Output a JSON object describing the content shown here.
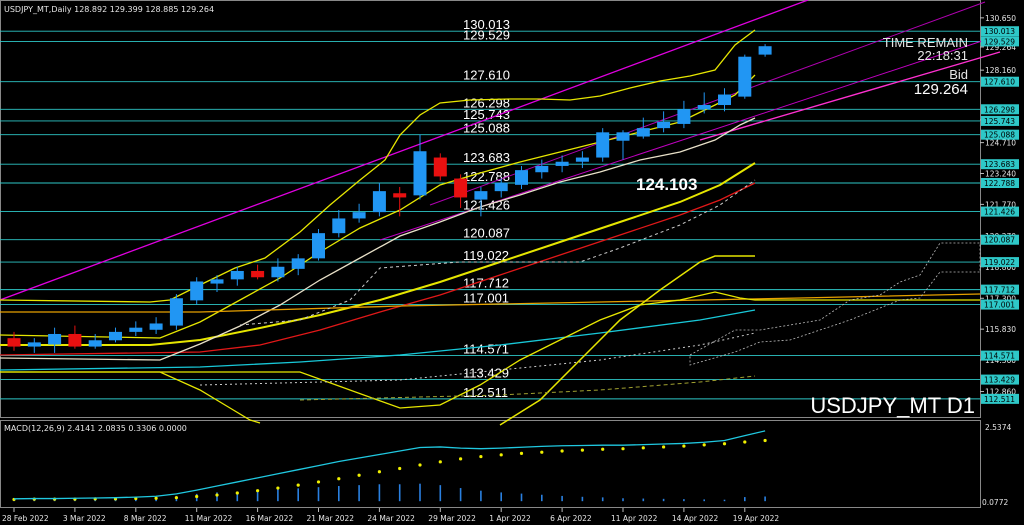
{
  "header": {
    "symbol_info": "USDJPY_MT,Daily  128.892 129.399 128.885 129.264"
  },
  "overlay": {
    "symbol_big": "USDJPY_MT D1",
    "time_remain_label": "TIME REMAIN",
    "time_remain_value": "22:18:31",
    "bid_label": "Bid",
    "bid_value": "129.264",
    "callout": "124.103"
  },
  "chart_data": {
    "type": "candlestick",
    "price_axis": {
      "range": [
        111.6,
        131.5
      ],
      "ticks": [
        "130.650",
        "129.264",
        "128.160",
        "125.790",
        "124.710",
        "123.240",
        "121.770",
        "120.270",
        "118.800",
        "117.300",
        "115.830",
        "114.360",
        "112.860"
      ],
      "tagged": [
        "130.013",
        "129.529",
        "127.610",
        "126.298",
        "125.743",
        "125.088",
        "123.683",
        "122.788",
        "121.426",
        "120.087",
        "119.022",
        "117.712",
        "117.001",
        "114.571",
        "113.429",
        "112.511"
      ]
    },
    "levels": [
      {
        "label": "130.013",
        "value": 130.013
      },
      {
        "label": "129.529",
        "value": 129.529
      },
      {
        "label": "127.610",
        "value": 127.61
      },
      {
        "label": "126.298",
        "value": 126.298
      },
      {
        "label": "125.743",
        "value": 125.743
      },
      {
        "label": "125.088",
        "value": 125.088
      },
      {
        "label": "123.683",
        "value": 123.683
      },
      {
        "label": "122.788",
        "value": 122.788
      },
      {
        "label": "121.426",
        "value": 121.426
      },
      {
        "label": "120.087",
        "value": 120.087
      },
      {
        "label": "119.022",
        "value": 119.022
      },
      {
        "label": "117.712",
        "value": 117.712
      },
      {
        "label": "117.001",
        "value": 117.001
      },
      {
        "label": "114.571",
        "value": 114.571
      },
      {
        "label": "113.429",
        "value": 113.429
      },
      {
        "label": "112.511",
        "value": 112.511
      }
    ],
    "x_labels": [
      {
        "label": "28 Feb 2022",
        "index": 0
      },
      {
        "label": "3 Mar 2022",
        "index": 3
      },
      {
        "label": "8 Mar 2022",
        "index": 6
      },
      {
        "label": "11 Mar 2022",
        "index": 9
      },
      {
        "label": "16 Mar 2022",
        "index": 12
      },
      {
        "label": "21 Mar 2022",
        "index": 15
      },
      {
        "label": "24 Mar 2022",
        "index": 18
      },
      {
        "label": "29 Mar 2022",
        "index": 21
      },
      {
        "label": "1 Apr 2022",
        "index": 24
      },
      {
        "label": "6 Apr 2022",
        "index": 27
      },
      {
        "label": "11 Apr 2022",
        "index": 30
      },
      {
        "label": "14 Apr 2022",
        "index": 33
      },
      {
        "label": "19 Apr 2022",
        "index": 36
      }
    ],
    "candles": [
      {
        "o": 115.4,
        "h": 115.7,
        "l": 114.8,
        "c": 115.0
      },
      {
        "o": 115.0,
        "h": 115.4,
        "l": 114.7,
        "c": 115.2
      },
      {
        "o": 115.1,
        "h": 115.9,
        "l": 114.7,
        "c": 115.6
      },
      {
        "o": 115.6,
        "h": 116.0,
        "l": 114.9,
        "c": 115.0
      },
      {
        "o": 115.0,
        "h": 115.6,
        "l": 114.9,
        "c": 115.3
      },
      {
        "o": 115.3,
        "h": 115.9,
        "l": 115.2,
        "c": 115.7
      },
      {
        "o": 115.7,
        "h": 116.2,
        "l": 115.5,
        "c": 115.9
      },
      {
        "o": 115.8,
        "h": 116.4,
        "l": 115.6,
        "c": 116.1
      },
      {
        "o": 116.0,
        "h": 117.5,
        "l": 115.8,
        "c": 117.3
      },
      {
        "o": 117.2,
        "h": 118.3,
        "l": 117.0,
        "c": 118.1
      },
      {
        "o": 118.0,
        "h": 118.4,
        "l": 117.6,
        "c": 118.2
      },
      {
        "o": 118.2,
        "h": 118.8,
        "l": 117.9,
        "c": 118.6
      },
      {
        "o": 118.6,
        "h": 118.9,
        "l": 118.2,
        "c": 118.3
      },
      {
        "o": 118.3,
        "h": 119.2,
        "l": 118.1,
        "c": 118.8
      },
      {
        "o": 118.7,
        "h": 119.4,
        "l": 118.4,
        "c": 119.2
      },
      {
        "o": 119.2,
        "h": 120.6,
        "l": 119.1,
        "c": 120.4
      },
      {
        "o": 120.4,
        "h": 121.5,
        "l": 120.2,
        "c": 121.1
      },
      {
        "o": 121.1,
        "h": 121.8,
        "l": 120.9,
        "c": 121.4
      },
      {
        "o": 121.4,
        "h": 122.8,
        "l": 121.2,
        "c": 122.4
      },
      {
        "o": 122.3,
        "h": 122.6,
        "l": 121.2,
        "c": 122.1
      },
      {
        "o": 122.2,
        "h": 125.1,
        "l": 122.0,
        "c": 124.3
      },
      {
        "o": 124.0,
        "h": 124.2,
        "l": 122.9,
        "c": 123.1
      },
      {
        "o": 123.0,
        "h": 123.2,
        "l": 121.6,
        "c": 122.1
      },
      {
        "o": 122.0,
        "h": 122.6,
        "l": 121.2,
        "c": 122.4
      },
      {
        "o": 122.4,
        "h": 123.0,
        "l": 122.1,
        "c": 122.8
      },
      {
        "o": 122.7,
        "h": 123.6,
        "l": 122.5,
        "c": 123.4
      },
      {
        "o": 123.3,
        "h": 123.9,
        "l": 123.0,
        "c": 123.6
      },
      {
        "o": 123.6,
        "h": 124.1,
        "l": 123.3,
        "c": 123.8
      },
      {
        "o": 123.8,
        "h": 124.3,
        "l": 123.5,
        "c": 124.0
      },
      {
        "o": 124.0,
        "h": 125.4,
        "l": 123.8,
        "c": 125.2
      },
      {
        "o": 124.8,
        "h": 125.3,
        "l": 123.9,
        "c": 125.2
      },
      {
        "o": 125.0,
        "h": 125.9,
        "l": 124.9,
        "c": 125.4
      },
      {
        "o": 125.4,
        "h": 126.2,
        "l": 125.2,
        "c": 125.7
      },
      {
        "o": 125.6,
        "h": 126.7,
        "l": 125.4,
        "c": 126.3
      },
      {
        "o": 126.3,
        "h": 127.1,
        "l": 126.1,
        "c": 126.5
      },
      {
        "o": 126.5,
        "h": 127.3,
        "l": 126.2,
        "c": 127.0
      },
      {
        "o": 126.9,
        "h": 128.9,
        "l": 126.8,
        "c": 128.8
      },
      {
        "o": 128.9,
        "h": 129.4,
        "l": 128.8,
        "c": 129.3
      }
    ],
    "macd": {
      "label": "MACD(12,26,9) 2.4141 2.0835 0.3306 0.0000",
      "range": [
        -0.2,
        2.75
      ],
      "ticks": [
        "2.5374"
      ],
      "bottom_tick": "0.0772",
      "histogram": [
        0.05,
        0.05,
        0.06,
        0.05,
        0.05,
        0.07,
        0.08,
        0.1,
        0.18,
        0.25,
        0.3,
        0.33,
        0.36,
        0.4,
        0.44,
        0.48,
        0.52,
        0.55,
        0.58,
        0.58,
        0.6,
        0.55,
        0.45,
        0.36,
        0.3,
        0.26,
        0.22,
        0.18,
        0.15,
        0.13,
        0.1,
        0.09,
        0.08,
        0.07,
        0.06,
        0.05,
        0.14,
        0.16
      ],
      "signal": [
        0.06,
        0.07,
        0.07,
        0.07,
        0.08,
        0.08,
        0.09,
        0.1,
        0.12,
        0.16,
        0.21,
        0.28,
        0.36,
        0.45,
        0.55,
        0.66,
        0.77,
        0.89,
        1.01,
        1.12,
        1.24,
        1.35,
        1.45,
        1.53,
        1.59,
        1.64,
        1.68,
        1.72,
        1.75,
        1.78,
        1.8,
        1.83,
        1.86,
        1.89,
        1.93,
        1.97,
        2.03,
        2.08
      ],
      "macd_line": [
        0.08,
        0.09,
        0.09,
        0.1,
        0.11,
        0.12,
        0.14,
        0.17,
        0.25,
        0.38,
        0.52,
        0.66,
        0.8,
        0.94,
        1.08,
        1.22,
        1.36,
        1.48,
        1.6,
        1.72,
        1.84,
        1.86,
        1.82,
        1.8,
        1.82,
        1.85,
        1.88,
        1.9,
        1.91,
        1.92,
        1.92,
        1.94,
        1.96,
        1.98,
        2.02,
        2.08,
        2.25,
        2.41
      ]
    }
  },
  "colors": {
    "background": "#000000",
    "grid": "#6a6a6a",
    "level_line": "#2ec8c8",
    "bull": "#2196f3",
    "bear": "#e81010",
    "channel": "#e000e0",
    "band": "#e6e600",
    "ma_red": "#e01818",
    "ma_cyan": "#18c8d8",
    "ma_white": "#e8e0c8",
    "tag_bg": "#2ec8c8",
    "macd_line": "#20c8e0",
    "macd_signal": "#f0f000",
    "macd_hist": "#2a80e0"
  }
}
